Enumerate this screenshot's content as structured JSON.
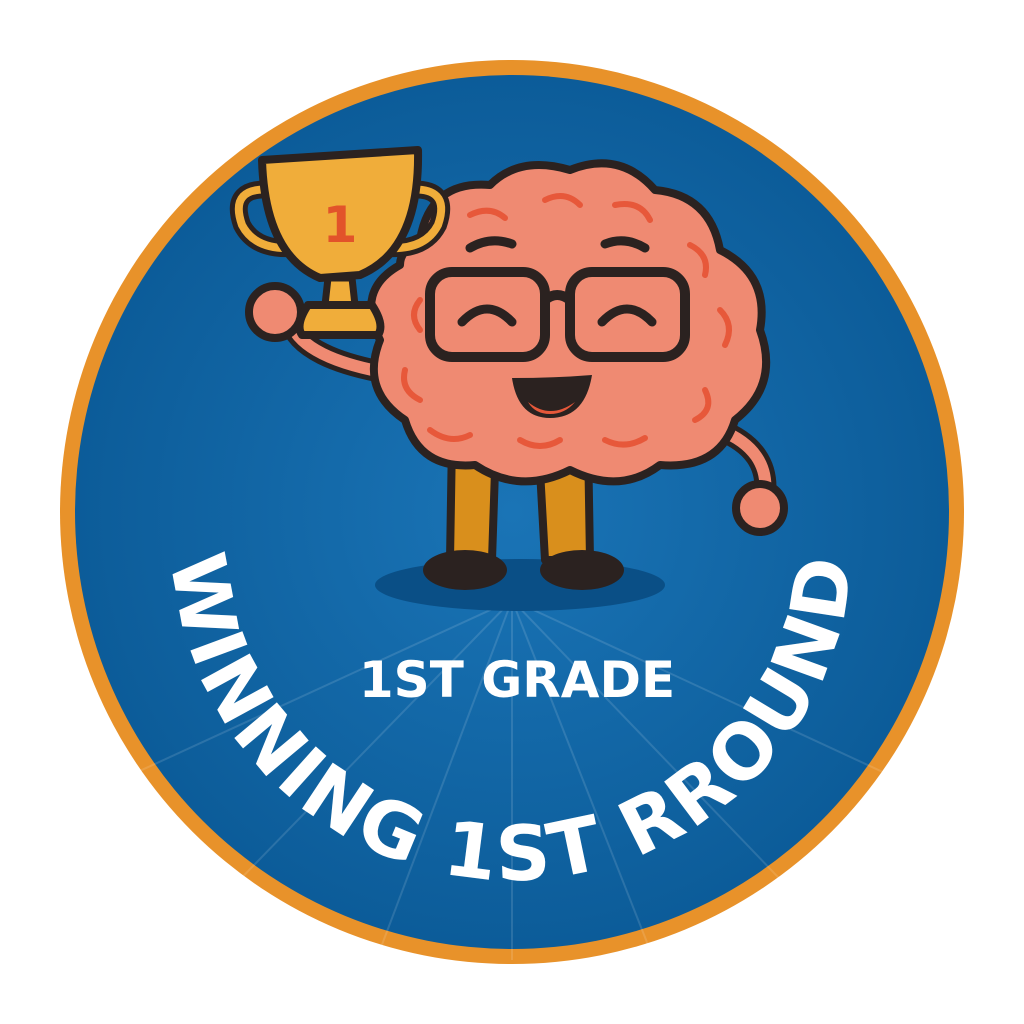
{
  "badge": {
    "arc_title": "WINNING 1ST RROUND",
    "subtitle": "1ST GRADE",
    "trophy_number": "1"
  },
  "icons": {
    "mascot": "brain-mascot-icon",
    "trophy": "trophy-icon",
    "glasses": "glasses-icon"
  },
  "colors": {
    "ring": "#e8922a",
    "disc": "#0f67a8",
    "disc_dark": "#0c5a96",
    "brain": "#ef8a72",
    "brain_detail": "#e7583a",
    "trophy": "#f0ad3a",
    "pants": "#d98f1c",
    "outline": "#2b2220",
    "text": "#ffffff"
  }
}
